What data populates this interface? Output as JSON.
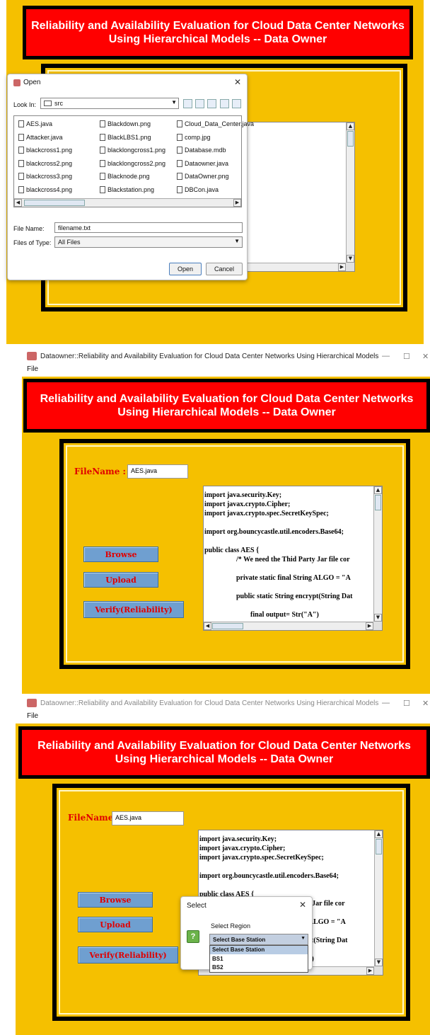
{
  "app": {
    "banner_title": "Reliability and Availability Evaluation for Cloud Data Center Networks\nUsing Hierarchical Models -- Data Owner",
    "window_title": "Dataowner::Reliability and Availability Evaluation for Cloud Data Center Networks Using Hierarchical Models",
    "menu_file": "File",
    "filename_label": "FileName :",
    "buttons": {
      "browse": "Browse",
      "upload": "Upload",
      "verify": "Verify(Reliability)"
    },
    "colors": {
      "background": "#f5c000",
      "banner": "#ff0000",
      "button": "#6f9fd0",
      "label": "#e00000"
    }
  },
  "open_dialog": {
    "title": "Open",
    "look_in_label": "Look In:",
    "look_in_value": "src",
    "files_col1": [
      "AES.java",
      "Attacker.java",
      "blackcross1.png",
      "blackcross2.png",
      "blackcross3.png",
      "blackcross4.png"
    ],
    "files_col2": [
      "Blackdown.png",
      "BlackLBS1.png",
      "blacklongcross1.png",
      "blacklongcross2.png",
      "Blacknode.png",
      "Blackstation.png"
    ],
    "files_col3": [
      "Cloud_Data_Center.java",
      "comp.jpg",
      "Database.mdb",
      "Dataowner.java",
      "DataOwner.png",
      "DBCon.java"
    ],
    "file_name_label": "File Name:",
    "file_name_value": "filename.txt",
    "files_of_type_label": "Files of Type:",
    "files_of_type_value": "All Files",
    "open_button": "Open",
    "cancel_button": "Cancel"
  },
  "editor": {
    "filename_value": "AES.java",
    "code": "import java.security.Key;\nimport javax.crypto.Cipher;\nimport javax.crypto.spec.SecretKeySpec;\n\nimport org.bouncycastle.util.encoders.Base64;\n\npublic class AES {\n                  /* We need the Thid Party Jar file cor\n\n                  private static final String ALGO = \"A\n\n                  public static String encrypt(String Dat\n\n                          final output= Str(\"A\")"
  },
  "select_dialog": {
    "title": "Select",
    "prompt": "Select Region",
    "selected": "Select Base Station",
    "options": [
      "Select Base Station",
      "BS1",
      "BS2"
    ],
    "question_icon": "question-icon"
  }
}
